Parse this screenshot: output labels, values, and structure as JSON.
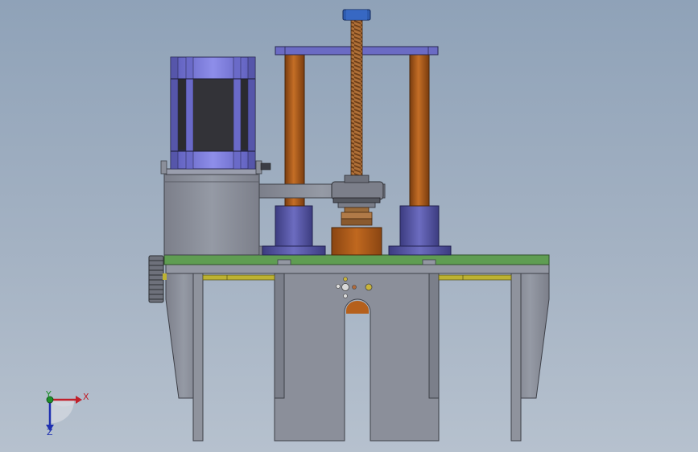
{
  "scene": {
    "description_type": "cad-model-front-view",
    "colors": {
      "frame_gray": "#8b8e99",
      "frame_dark": "#5a5d66",
      "motor_blue": "#7a7ad6",
      "motor_body": "#2b2b2e",
      "column_brown": "#b0601d",
      "collar_blue": "#5a5aa8",
      "plate_green": "#5f9d52",
      "rail_yellow": "#bdb232",
      "block_brown": "#b5601c",
      "screw_orange": "#9a5a2a",
      "knob_blue": "#2e5cb0"
    }
  },
  "axis_triad": {
    "x_label": "X",
    "y_label": "Y",
    "z_label": "Z",
    "x_color": "#c0202a",
    "y_color": "#1e8f2a",
    "z_color": "#1e2fb0"
  }
}
